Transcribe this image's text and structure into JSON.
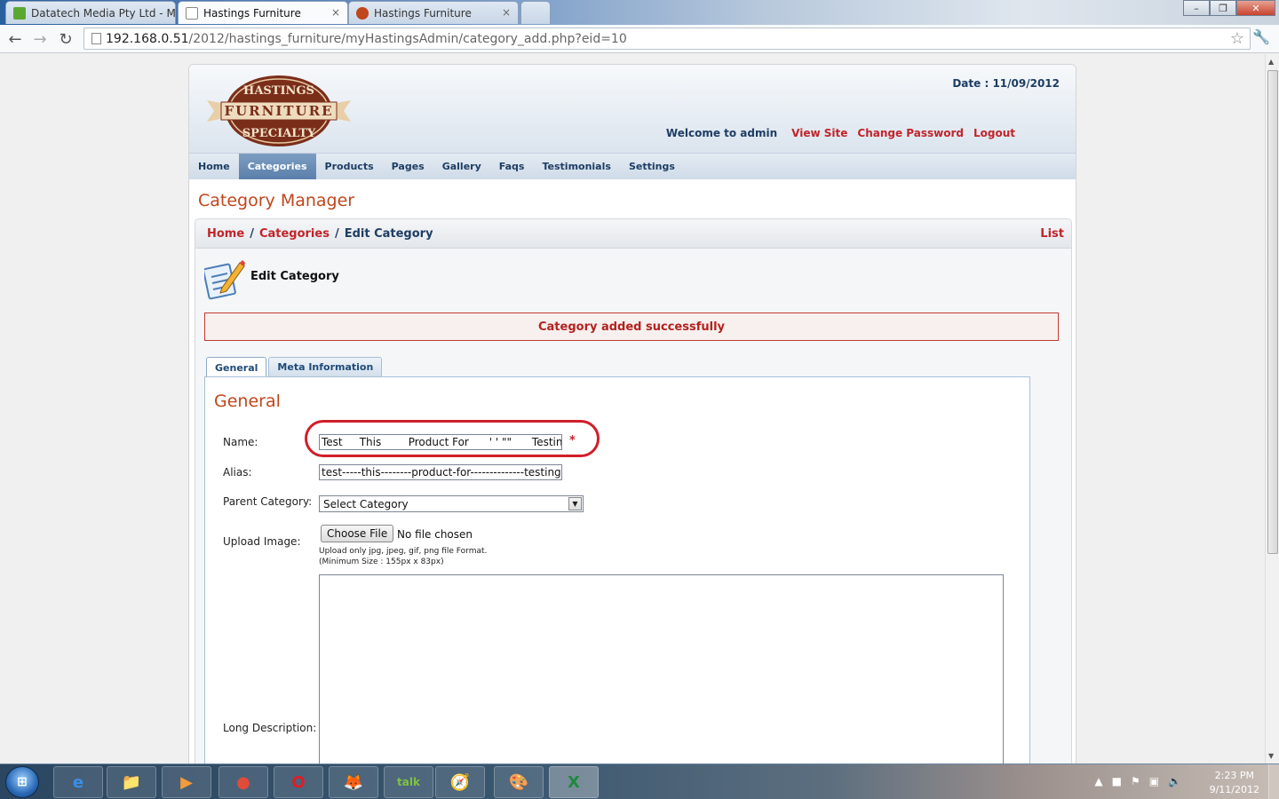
{
  "browser": {
    "tabs": [
      {
        "title": "Datatech Media Pty Ltd - M",
        "active": false,
        "favicon_color": "#5aa832"
      },
      {
        "title": "Hastings Furniture",
        "active": true,
        "favicon_color": "#ffffff"
      },
      {
        "title": "Hastings Furniture",
        "active": false,
        "favicon_color": "#c0461c"
      }
    ],
    "close_glyph": "×",
    "url_host": "192.168.0.51",
    "url_path": "/2012/hastings_furniture/myHastingsAdmin/category_add.php?eid=10",
    "window_controls": [
      "–",
      "❐",
      "✕"
    ]
  },
  "header": {
    "logo_top": "HASTINGS",
    "logo_mid": "FURNITURE",
    "logo_bottom": "SPECIALTY",
    "date_label": "Date :",
    "date_value": "11/09/2012",
    "welcome": "Welcome to admin",
    "links": [
      "View Site",
      "Change Password",
      "Logout"
    ]
  },
  "nav": {
    "items": [
      "Home",
      "Categories",
      "Products",
      "Pages",
      "Gallery",
      "Faqs",
      "Testimonials",
      "Settings"
    ],
    "active_index": 1
  },
  "page": {
    "title": "Category Manager",
    "breadcrumb": [
      "Home",
      "Categories",
      "Edit Category"
    ],
    "breadcrumb_sep": "/",
    "list_link": "List",
    "edit_heading": "Edit Category",
    "message": "Category added successfully"
  },
  "form": {
    "tabs": [
      "General",
      "Meta Information"
    ],
    "active_tab": 0,
    "heading": "General",
    "name_label": "Name:",
    "name_value": "Test     This        Product For      ' ' \"\"      Testin",
    "required_mark": "*",
    "alias_label": "Alias:",
    "alias_value": "test-----this--------product-for--------------testing-pur",
    "parent_label": "Parent Category:",
    "parent_value": "Select Category",
    "upload_label": "Upload Image:",
    "choose_file": "Choose File",
    "no_file": "No file chosen",
    "upload_hint1": "Upload only jpg, jpeg, gif, png file Format.",
    "upload_hint2": "(Minimum Size : 155px x 83px)",
    "long_desc_label": "Long Description:"
  },
  "taskbar": {
    "start_glyph": "⊞",
    "apps": [
      "e",
      "📁",
      "▶",
      "●",
      "O",
      "🦊",
      "talk",
      "🧭",
      "🎨",
      "X"
    ],
    "time": "2:23 PM",
    "date": "9/11/2012"
  },
  "colors": {
    "accent_red": "#c0242a",
    "title_orange": "#c0461c",
    "navy": "#1d3d63",
    "annotation_red": "#d11e2a"
  }
}
